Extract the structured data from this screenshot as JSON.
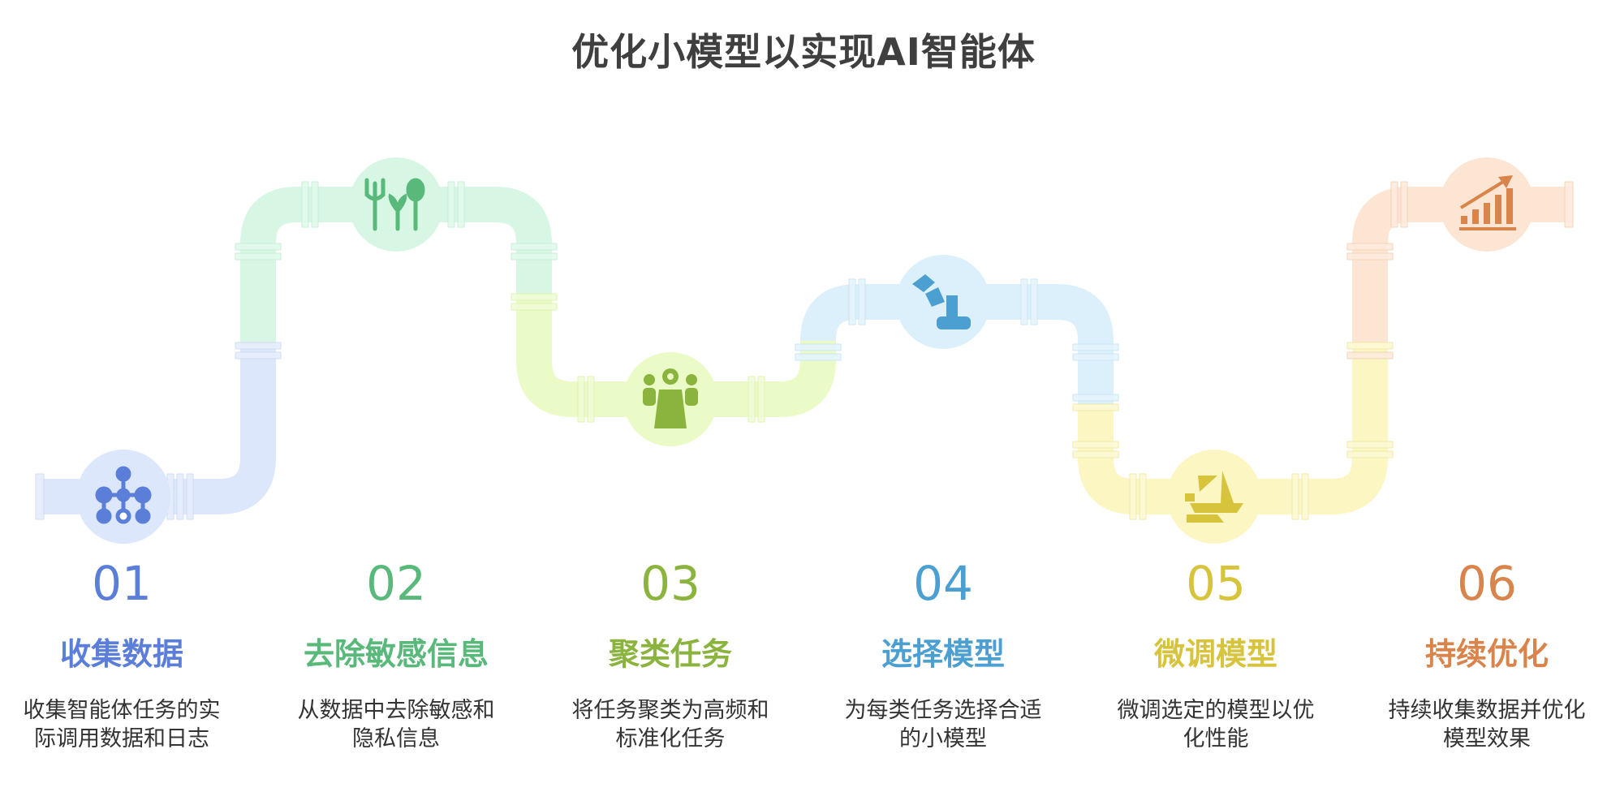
{
  "title": "优化小模型以实现AI智能体",
  "steps": [
    {
      "num": "01",
      "label": "收集数据",
      "desc_line1": "收集智能体任务的实",
      "desc_line2": "际调用数据和日志",
      "color": "#5b7fd9",
      "icon": "network-nodes-icon"
    },
    {
      "num": "02",
      "label": "去除敏感信息",
      "desc_line1": "从数据中去除敏感和",
      "desc_line2": "隐私信息",
      "color": "#58b97a",
      "icon": "utensils-leaf-icon"
    },
    {
      "num": "03",
      "label": "聚类任务",
      "desc_line1": "将任务聚类为高频和",
      "desc_line2": "标准化任务",
      "color": "#8bb43f",
      "icon": "people-group-icon"
    },
    {
      "num": "04",
      "label": "选择模型",
      "desc_line1": "为每类任务选择合适",
      "desc_line2": "的小模型",
      "color": "#4b9fd1",
      "icon": "robot-arm-icon"
    },
    {
      "num": "05",
      "label": "微调模型",
      "desc_line1": "微调选定的模型以优",
      "desc_line2": "化性能",
      "color": "#d8c33d",
      "icon": "sailboat-hand-icon"
    },
    {
      "num": "06",
      "label": "持续优化",
      "desc_line1": "持续收集数据并优化",
      "desc_line2": "模型效果",
      "color": "#d8844b",
      "icon": "chart-growth-icon"
    }
  ]
}
